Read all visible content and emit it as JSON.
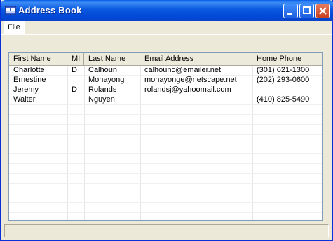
{
  "window": {
    "title": "Address Book"
  },
  "menu": {
    "file_label": "File"
  },
  "table": {
    "columns": [
      "First Name",
      "MI",
      "Last Name",
      "Email Address",
      "Home Phone"
    ],
    "rows": [
      [
        "Charlotte",
        "D",
        "Calhoun",
        "calhounc@emailer.net",
        "(301) 621-1300"
      ],
      [
        "Ernestine",
        "",
        "Monayong",
        "monayonge@netscape.net",
        "(202) 293-0600"
      ],
      [
        "Jeremy",
        "D",
        "Rolands",
        "rolandsj@yahoomail.com",
        ""
      ],
      [
        "Walter",
        "",
        "Nguyen",
        "",
        "(410) 825-5490"
      ]
    ]
  },
  "colors": {
    "titlebar": "#0a58e0",
    "close_button": "#c9401e",
    "window_bg": "#ece9d8"
  }
}
